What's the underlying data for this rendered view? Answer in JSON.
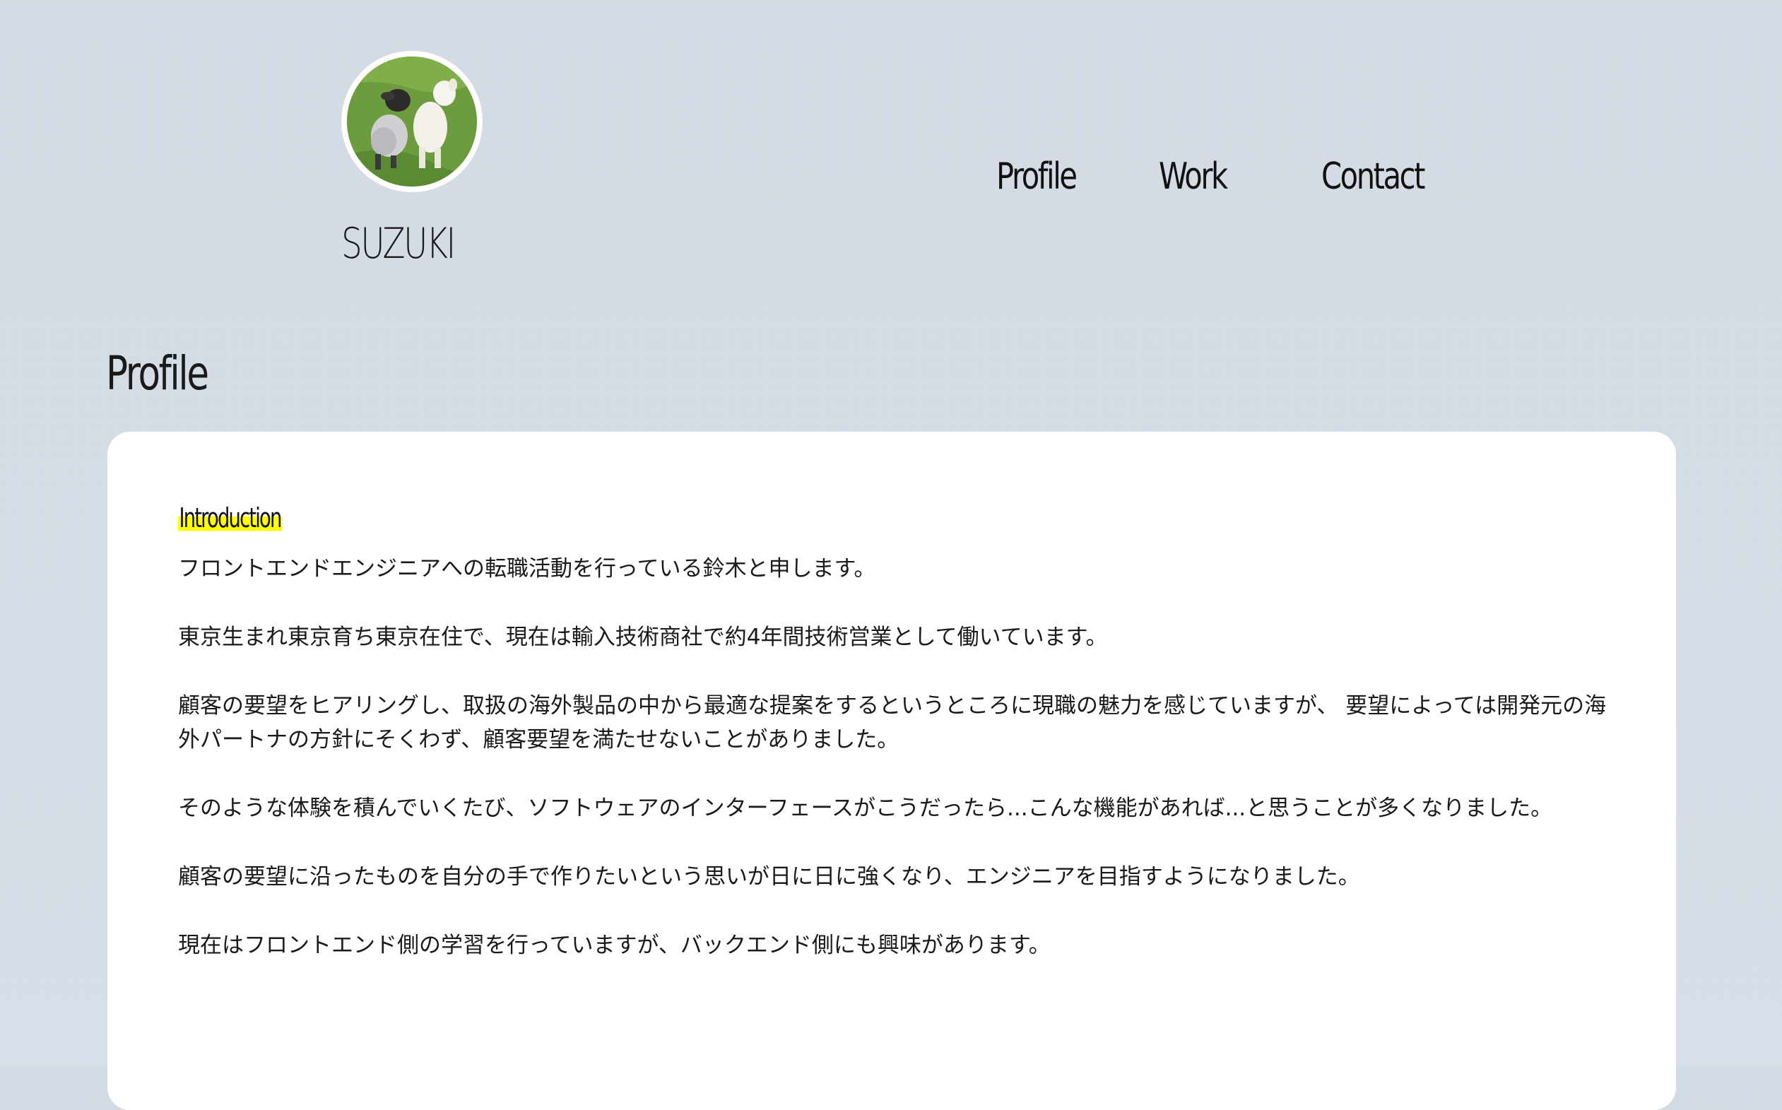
{
  "header": {
    "site_name": "SUZUKI",
    "avatar_alt": "Two lambs on grass"
  },
  "nav": {
    "items": [
      {
        "label": "Profile"
      },
      {
        "label": "Work"
      },
      {
        "label": "Contact"
      }
    ]
  },
  "profile_section": {
    "title": "Profile",
    "intro_heading": "Introduction",
    "paragraphs": [
      "フロントエンドエンジニアへの転職活動を行っている鈴木と申します。",
      "東京生まれ東京育ち東京在住で、現在は輸入技術商社で約4年間技術営業として働いています。",
      "顧客の要望をヒアリングし、取扱の海外製品の中から最適な提案をするというところに現職の魅力を感じていますが、 要望によっては開発元の海外パートナの方針にそくわず、顧客要望を満たせないことがありました。",
      "そのような体験を積んでいくたび、ソフトウェアのインターフェースがこうだったら...こんな機能があれば...と思うことが多くなりました。",
      "顧客の要望に沿ったものを自分の手で作りたいという思いが日に日に強くなり、エンジニアを目指すようになりました。",
      "現在はフロントエンド側の学習を行っていますが、バックエンド側にも興味があります。"
    ]
  },
  "colors": {
    "background": "#d4dbe4",
    "card": "#ffffff",
    "highlight": "#ffff00"
  }
}
